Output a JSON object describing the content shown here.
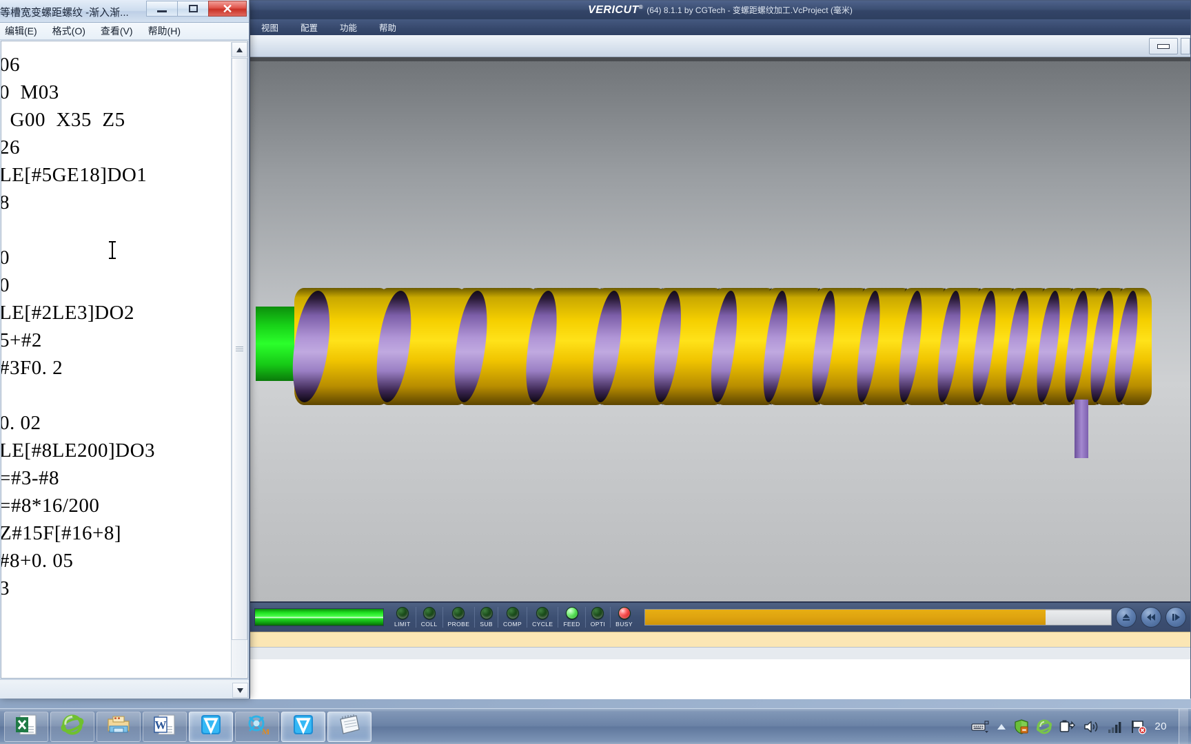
{
  "notepad": {
    "title": "等槽宽变螺距螺纹 -渐入渐...",
    "window_buttons": {
      "minimize": "−",
      "maximize": "□",
      "close": "✕"
    },
    "menu": [
      "编辑(E)",
      "格式(O)",
      "查看(V)",
      "帮助(H)"
    ],
    "content_lines": [
      "06",
      "0  M03",
      "  G00  X35  Z5",
      "26",
      "LE[#5GE18]DO1",
      "8",
      "",
      "0",
      "0",
      "LE[#2LE3]DO2",
      "5+#2",
      "#3F0. 2",
      "",
      "0. 02",
      "LE[#8LE200]DO3",
      "=#3-#8",
      "=#8*16/200",
      "Z#15F[#16+8]",
      "#8+0. 05",
      "3"
    ],
    "content_text": "06\n0  M03\n  G00  X35  Z5\n26\nLE[#5GE18]DO1\n8\n\n0\n0\nLE[#2LE3]DO2\n5+#2\n#3F0. 2\n\n0. 02\nLE[#8LE200]DO3\n=#3-#8\n=#8*16/200\nZ#15F[#16+8]\n#8+0. 05\n3"
  },
  "vericut": {
    "brand": "VERICUT",
    "brand_mark": "®",
    "title_rest": "(64) 8.1.1 by CGTech - 变螺距螺纹加工.VcProject (毫米)",
    "menu": [
      "视图",
      "配置",
      "功能",
      "帮助"
    ],
    "toolbar": {
      "minimize_label": "minimize-window-button"
    },
    "status_leds": [
      {
        "label": "LIMIT",
        "state": "off"
      },
      {
        "label": "COLL",
        "state": "off"
      },
      {
        "label": "PROBE",
        "state": "off"
      },
      {
        "label": "SUB",
        "state": "off"
      },
      {
        "label": "COMP",
        "state": "off"
      },
      {
        "label": "CYCLE",
        "state": "off"
      },
      {
        "label": "FEED",
        "state": "on-green"
      },
      {
        "label": "OPTI",
        "state": "off"
      },
      {
        "label": "BUSY",
        "state": "on-red"
      }
    ],
    "progress": {
      "percent": 86,
      "fill_color": "#dfa410"
    },
    "transport_buttons": [
      "eject-icon",
      "rewind-icon",
      "play-icon"
    ],
    "viewport": {
      "stock_color": "#22e022",
      "thread_gold_color": "#ffd400",
      "thread_groove_color": "#b095d6",
      "tool_color": "#8a6cbe",
      "background_top": "#6f7377",
      "background_mid": "#cfd1d3"
    }
  },
  "taskbar": {
    "items": [
      {
        "name": "excel",
        "label": "Microsoft Excel",
        "active": false
      },
      {
        "name": "internet-explorer",
        "label": "Internet Explorer",
        "active": false
      },
      {
        "name": "file-explorer",
        "label": "Windows Explorer",
        "active": false
      },
      {
        "name": "word",
        "label": "Microsoft Word",
        "active": false
      },
      {
        "name": "vericut-1",
        "label": "VERICUT",
        "active": true
      },
      {
        "name": "vericut-machine-sim",
        "label": "VERICUT Machine Simulation",
        "active": false
      },
      {
        "name": "vericut-2",
        "label": "VERICUT",
        "active": true
      },
      {
        "name": "notepad",
        "label": "记事本",
        "active": true
      }
    ],
    "tray": [
      "ime-keyboard-icon",
      "show-hidden-icons-icon",
      "security-shield-icon",
      "internet-explorer-icon",
      "battery-icon",
      "volume-icon",
      "network-signal-icon",
      "action-center-flag-icon"
    ],
    "clock": "20"
  }
}
